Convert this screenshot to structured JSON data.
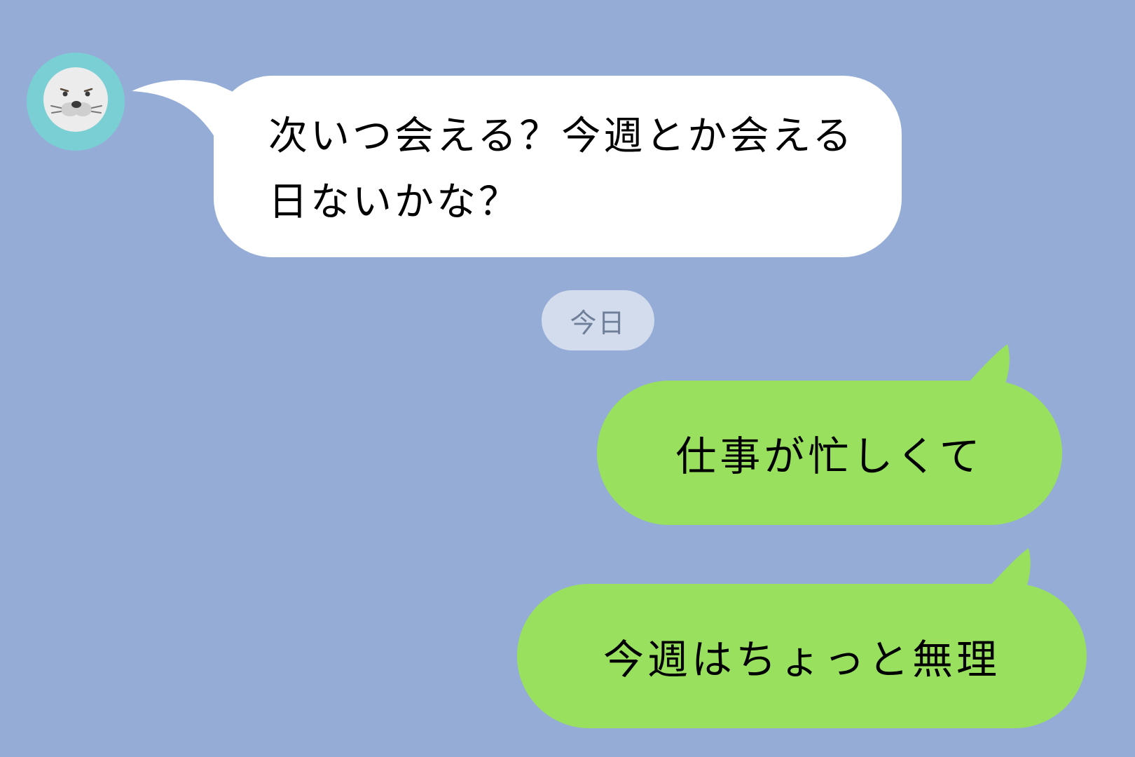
{
  "chat": {
    "incoming": {
      "avatar_icon": "seal-avatar-icon",
      "text": "次いつ会える？今週とか会える日ないかな？"
    },
    "date_separator": "今日",
    "outgoing": [
      {
        "text": "仕事が忙しくて"
      },
      {
        "text": "今週はちょっと無理"
      }
    ]
  },
  "colors": {
    "background": "#95acd6",
    "incoming_bubble": "#ffffff",
    "outgoing_bubble": "#99e05f",
    "date_pill": "#d3dcec",
    "date_text": "#6f7f99",
    "avatar_ring": "#79cfd4"
  }
}
